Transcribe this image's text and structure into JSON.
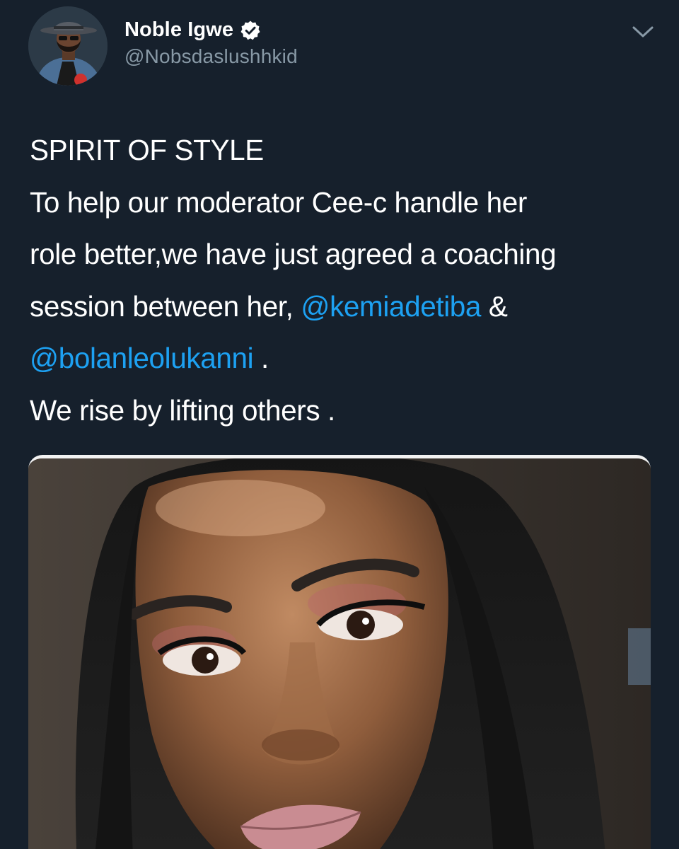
{
  "tweet": {
    "author": {
      "display_name": "Noble Igwe",
      "handle": "@Nobsdaslushhkid",
      "verified": true,
      "avatar_icon": "profile-photo"
    },
    "menu_icon": "chevron-down-icon",
    "text": {
      "line1": "SPIRIT OF STYLE",
      "line2": "To help our moderator Cee-c handle her",
      "line3": "role better,we have just agreed a coaching",
      "line4_prefix": "session between her, ",
      "mention1": "@kemiadetiba",
      "line4_suffix": " &",
      "mention2": "@bolanleolukanni",
      "line5_suffix": " .",
      "line6": "We rise by lifting others ."
    },
    "media": {
      "type": "photo"
    }
  },
  "colors": {
    "background": "#16202c",
    "text": "#ffffff",
    "secondary_text": "#8899a6",
    "link": "#1da1f2",
    "verified_badge": "#ffffff"
  }
}
